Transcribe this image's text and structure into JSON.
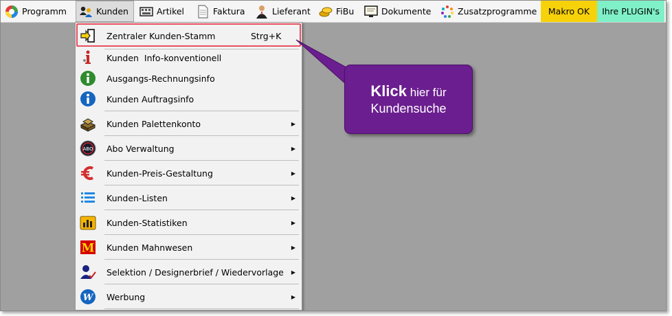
{
  "menubar": {
    "items": [
      {
        "label": "Programm",
        "icon": "colorful-ball-icon"
      },
      {
        "label": "Kunden",
        "icon": "customers-icon",
        "active": true
      },
      {
        "label": "Artikel",
        "icon": "keyboard-icon"
      },
      {
        "label": "Faktura",
        "icon": "document-icon"
      },
      {
        "label": "Lieferant",
        "icon": "person-icon"
      },
      {
        "label": "FiBu",
        "icon": "coins-icon"
      },
      {
        "label": "Dokumente",
        "icon": "monitor-icon"
      },
      {
        "label": "Zusatzprogramme",
        "icon": "dots-icon"
      }
    ],
    "badges": [
      {
        "label": "Makro OK",
        "color": "#f7d10a"
      },
      {
        "label": "Ihre PLUGIN's",
        "color": "#7ff0c8"
      }
    ]
  },
  "dropdown": {
    "items": [
      {
        "label": "Zentraler Kunden-Stamm",
        "shortcut": "Strg+K",
        "icon": "enter-door-icon",
        "submenu": false
      },
      {
        "label": "Kunden  Info-konventionell",
        "icon": "info-i-icon",
        "submenu": false
      },
      {
        "label": "Ausgangs-Rechnungsinfo",
        "icon": "green-info-icon",
        "submenu": false
      },
      {
        "label": "Kunden Auftragsinfo",
        "icon": "blue-info-icon",
        "submenu": false
      },
      {
        "label": "Kunden Palettenkonto",
        "icon": "pallet-icon",
        "submenu": true
      },
      {
        "label": "Abo Verwaltung",
        "icon": "abo-icon",
        "submenu": true
      },
      {
        "label": "Kunden-Preis-Gestaltung",
        "icon": "euro-icon",
        "submenu": true
      },
      {
        "label": "Kunden-Listen",
        "icon": "list-icon",
        "submenu": true
      },
      {
        "label": "Kunden-Statistiken",
        "icon": "statistics-icon",
        "submenu": true
      },
      {
        "label": "Kunden Mahnwesen",
        "icon": "dunning-m-icon",
        "submenu": true
      },
      {
        "label": "Selektion / Designerbrief / Wiedervorlage",
        "icon": "person-selection-icon",
        "submenu": true
      },
      {
        "label": "Werbung",
        "icon": "advertising-w-icon",
        "submenu": true
      }
    ]
  },
  "callout": {
    "bold": "Klick",
    "line1_rest": " hier für",
    "line2": "Kundensuche",
    "color": "#6b1e8f"
  },
  "submenu_arrow": "▶"
}
